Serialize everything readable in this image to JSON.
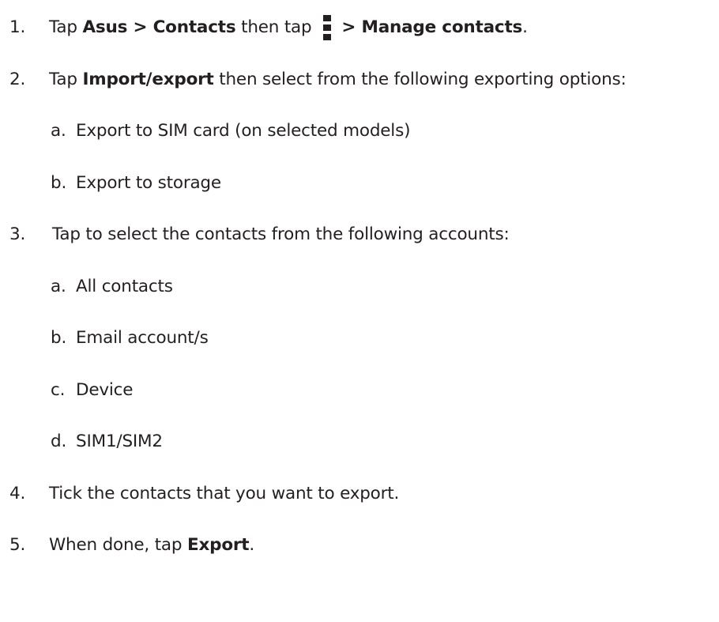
{
  "steps": [
    {
      "number": "1.",
      "pre": "Tap ",
      "b1": "Asus",
      "sep1": " > ",
      "b2": "Contacts",
      "mid": " then tap ",
      "icon": "overflow-menu-icon",
      "sep2": " > ",
      "b3": "Manage contacts",
      "end": "."
    },
    {
      "number": "2.",
      "pre": "Tap ",
      "b1": "Import/export",
      "post": " then select from the following exporting options:",
      "options": [
        {
          "letter": "a.",
          "text": "Export to SIM card (on selected models)"
        },
        {
          "letter": "b.",
          "text": "Export to storage"
        }
      ]
    },
    {
      "number": "3.",
      "text": "Tap to select the contacts from the following accounts:",
      "options": [
        {
          "letter": "a.",
          "text": "All contacts"
        },
        {
          "letter": "b.",
          "text": "Email account/s"
        },
        {
          "letter": "c.",
          "text": "Device"
        },
        {
          "letter": "d.",
          "text": "SIM1/SIM2"
        }
      ]
    },
    {
      "number": "4.",
      "text": "Tick the contacts that you want to export."
    },
    {
      "number": "5.",
      "pre": "When done, tap ",
      "b1": "Export",
      "end": "."
    }
  ]
}
